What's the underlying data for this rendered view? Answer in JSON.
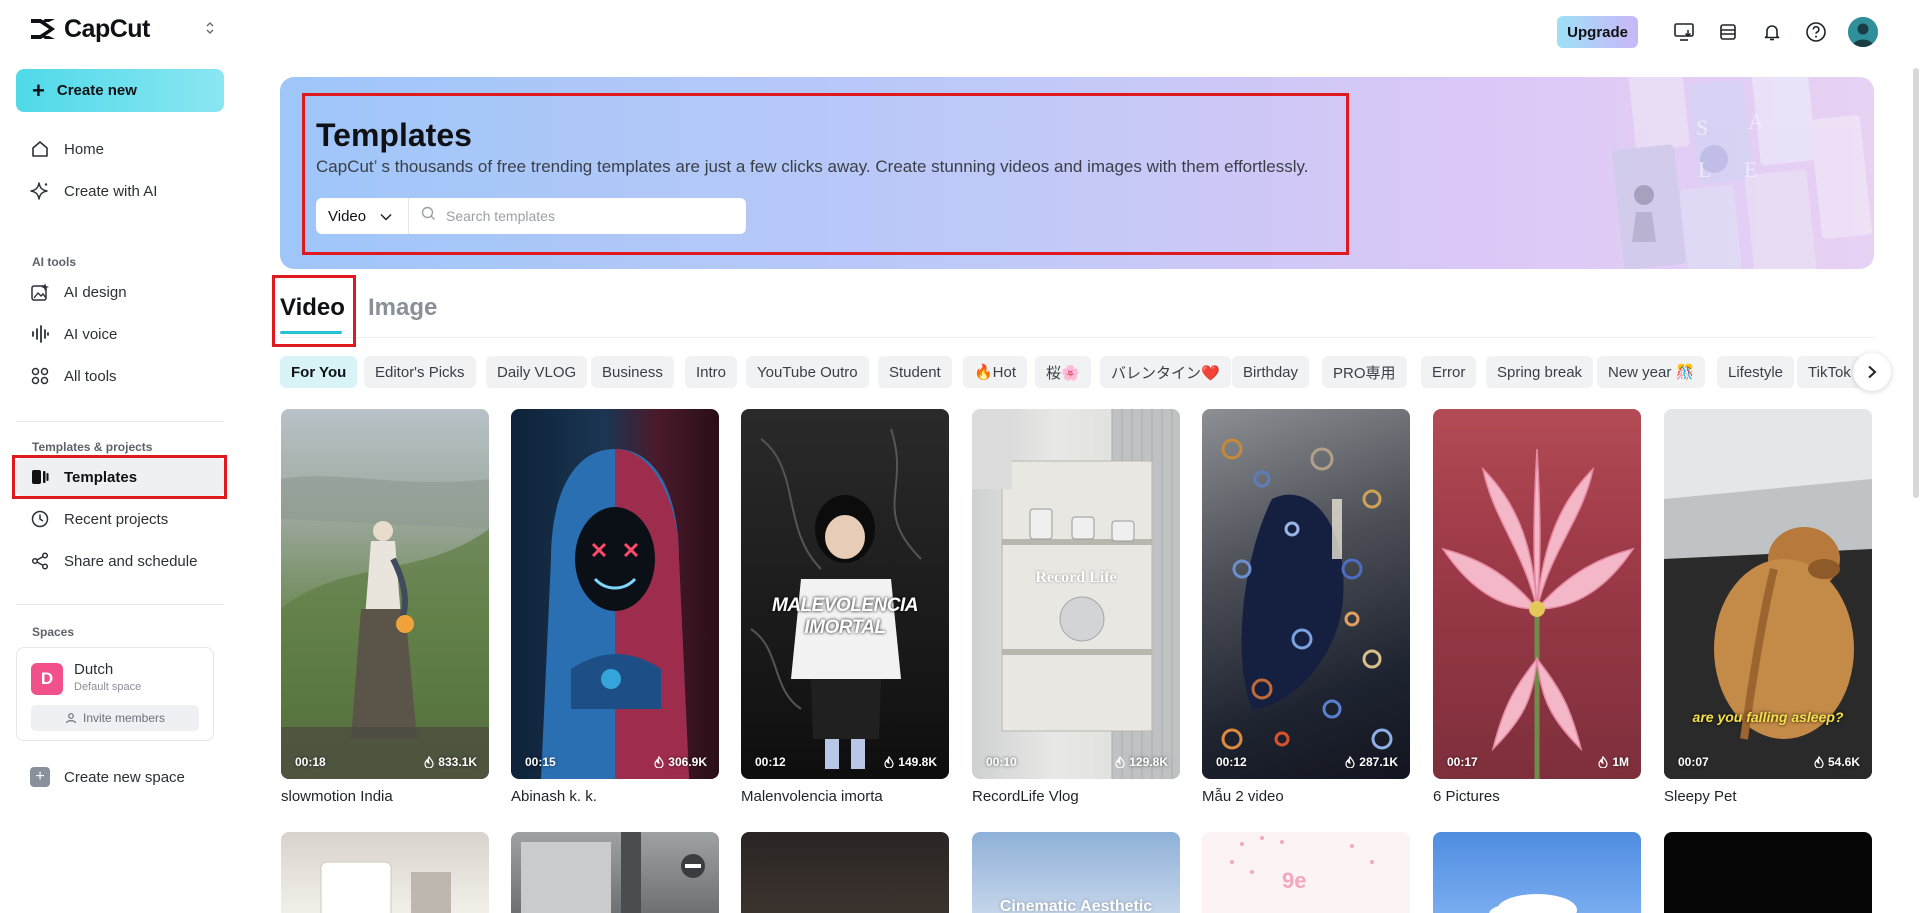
{
  "brand": {
    "name": "CapCut"
  },
  "sidebar": {
    "create_label": "Create new",
    "nav_main": [
      {
        "label": "Home",
        "icon": "home-icon"
      },
      {
        "label": "Create with AI",
        "icon": "sparkle-icon"
      }
    ],
    "ai_tools_label": "AI tools",
    "ai_tools": [
      {
        "label": "AI design",
        "icon": "image-edit-icon"
      },
      {
        "label": "AI voice",
        "icon": "waveform-icon"
      },
      {
        "label": "All tools",
        "icon": "grid-icon"
      }
    ],
    "projects_label": "Templates & projects",
    "projects": [
      {
        "label": "Templates",
        "icon": "templates-icon",
        "active": true
      },
      {
        "label": "Recent projects",
        "icon": "clock-icon"
      },
      {
        "label": "Share and schedule",
        "icon": "share-icon"
      }
    ],
    "spaces_label": "Spaces",
    "space": {
      "initial": "D",
      "name": "Dutch",
      "subtitle": "Default space",
      "invite_label": "Invite members",
      "color": "#f2508a"
    },
    "create_space_label": "Create new space"
  },
  "topbar": {
    "upgrade_label": "Upgrade"
  },
  "banner": {
    "title": "Templates",
    "description": "CapCut’ s thousands of free trending templates are just a few clicks away. Create stunning videos and images with them effortlessly.",
    "search_type": "Video",
    "search_placeholder": "Search templates"
  },
  "tabs": {
    "video": "Video",
    "image": "Image"
  },
  "chips": [
    "For You",
    "Editor's Picks",
    "Daily VLOG",
    "Business",
    "Intro",
    "YouTube Outro",
    "Student",
    "🔥Hot",
    "桜🌸",
    "バレンタイン❤️",
    "Birthday",
    "PRO専用",
    "Error",
    "Spring break",
    "New year 🎊",
    "Lifestyle",
    "TikTok"
  ],
  "templates": [
    {
      "title": "slowmotion India",
      "duration": "00:18",
      "uses": "833.1K"
    },
    {
      "title": "Abinash k. k.",
      "duration": "00:15",
      "uses": "306.9K"
    },
    {
      "title": "Malenvolencia imorta",
      "duration": "00:12",
      "uses": "149.8K",
      "overlay": "MALEVOLENCIA IMORTAL"
    },
    {
      "title": "RecordLife Vlog",
      "duration": "00:10",
      "uses": "129.8K",
      "overlay": "Record  Life"
    },
    {
      "title": "Mẫu 2 video",
      "duration": "00:12",
      "uses": "287.1K"
    },
    {
      "title": "6 Pictures",
      "duration": "00:17",
      "uses": "1M"
    },
    {
      "title": "Sleepy Pet",
      "duration": "00:07",
      "uses": "54.6K",
      "overlay": "are you falling asleep?"
    }
  ],
  "row2": {
    "overlay_4": "Cinematic Aesthetic"
  },
  "colors": {
    "accent": "#22c3d3",
    "highlight_red": "#e0191f"
  }
}
